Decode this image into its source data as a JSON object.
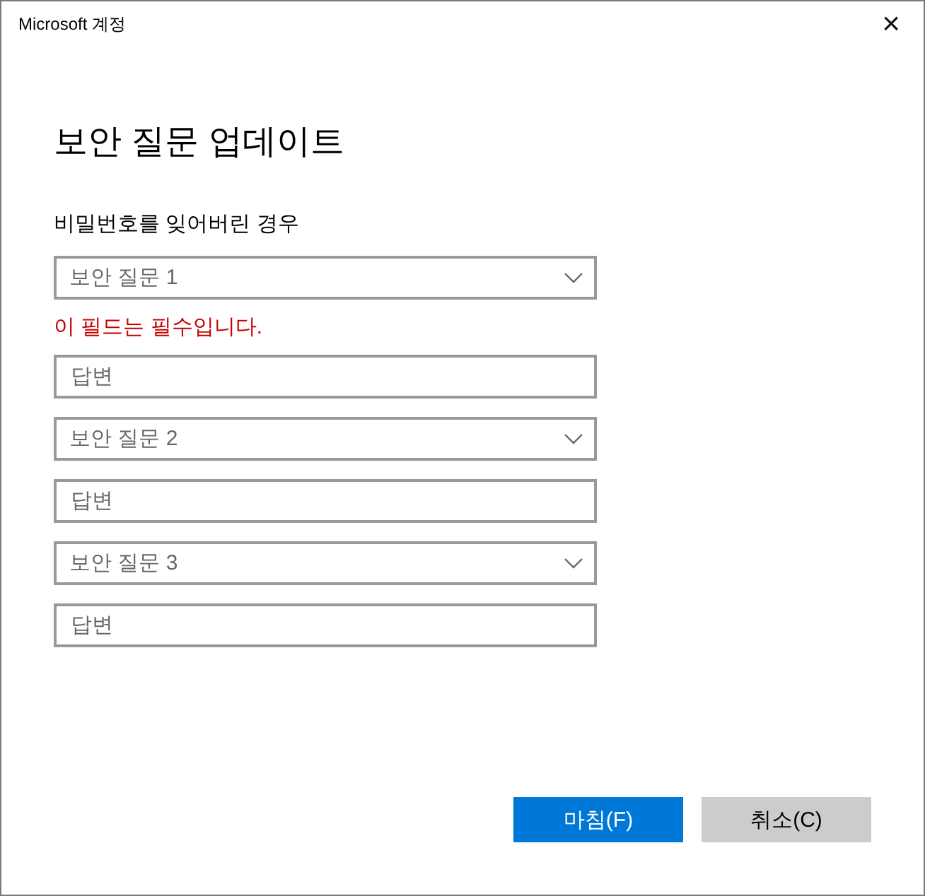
{
  "window": {
    "title": "Microsoft 계정",
    "close": "×"
  },
  "heading": "보안 질문 업데이트",
  "section_label": "비밀번호를 잊어버린 경우",
  "items": [
    {
      "kind": "select",
      "value": "보안 질문 1"
    },
    {
      "kind": "error",
      "text": "이 필드는 필수입니다."
    },
    {
      "kind": "answer",
      "placeholder": "답변"
    },
    {
      "kind": "select",
      "value": "보안 질문 2"
    },
    {
      "kind": "answer",
      "placeholder": "답변"
    },
    {
      "kind": "select",
      "value": "보안 질문 3"
    },
    {
      "kind": "answer",
      "placeholder": "답변"
    }
  ],
  "buttons": [
    {
      "label": "마침(F)",
      "primary": true
    },
    {
      "label": "취소(C)",
      "primary": false
    }
  ]
}
